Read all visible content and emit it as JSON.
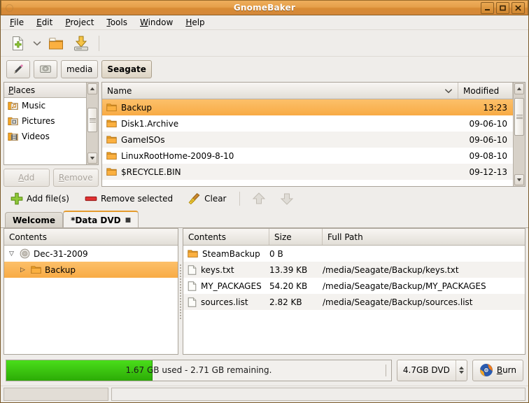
{
  "window": {
    "title": "GnomeBaker",
    "minimize_label": "Minimize",
    "maximize_label": "Maximize",
    "close_label": "Close"
  },
  "menubar": {
    "items": [
      {
        "label": "File",
        "mnemonic": "F"
      },
      {
        "label": "Edit",
        "mnemonic": "E"
      },
      {
        "label": "Project",
        "mnemonic": "P"
      },
      {
        "label": "Tools",
        "mnemonic": "T"
      },
      {
        "label": "Window",
        "mnemonic": "W"
      },
      {
        "label": "Help",
        "mnemonic": "H"
      }
    ]
  },
  "toolbar": {
    "new_label": "New",
    "new_dropdown_label": "New project type",
    "open_label": "Open",
    "save_label": "Save",
    "icons": [
      "new-document-icon",
      "chevron-down-icon",
      "open-folder-icon",
      "save-disk-icon"
    ]
  },
  "pathbar": {
    "edit_location_label": "Edit location",
    "buttons": [
      {
        "label": "",
        "icon": "drive-icon"
      },
      {
        "label": "media",
        "icon": ""
      },
      {
        "label": "Seagate",
        "icon": "",
        "current": true
      }
    ]
  },
  "places": {
    "header": "Places",
    "header_mnemonic": "P",
    "items": [
      {
        "label": "Music",
        "icon": "music-folder-icon"
      },
      {
        "label": "Pictures",
        "icon": "pictures-folder-icon"
      },
      {
        "label": "Videos",
        "icon": "videos-folder-icon"
      }
    ],
    "add_label": "Add",
    "remove_label": "Remove"
  },
  "filelist": {
    "columns": {
      "name": "Name",
      "modified": "Modified"
    },
    "sort_indicator": "chevron-down-icon",
    "rows": [
      {
        "name": "Backup",
        "modified": "13:23",
        "selected": true
      },
      {
        "name": "Disk1.Archive",
        "modified": "09-06-10",
        "selected": false
      },
      {
        "name": "GameISOs",
        "modified": "09-06-10",
        "selected": false
      },
      {
        "name": "LinuxRootHome-2009-8-10",
        "modified": "09-08-10",
        "selected": false
      },
      {
        "name": "$RECYCLE.BIN",
        "modified": "09-12-13",
        "selected": false
      }
    ]
  },
  "actions": {
    "add_files": "Add file(s)",
    "remove_selected": "Remove selected",
    "clear": "Clear",
    "move_up_label": "Move up",
    "move_down_label": "Move down"
  },
  "tabs": [
    {
      "label": "Welcome",
      "active": false,
      "mark": ""
    },
    {
      "label": "*Data DVD",
      "active": true,
      "mark": "■"
    }
  ],
  "tree": {
    "header": "Contents",
    "nodes": [
      {
        "label": "Dec-31-2009",
        "icon": "disc-icon",
        "expander": "▽",
        "indent": 0,
        "selected": false
      },
      {
        "label": "Backup",
        "icon": "folder-icon",
        "expander": "▷",
        "indent": 1,
        "selected": true
      }
    ]
  },
  "contents": {
    "columns": {
      "name": "Contents",
      "size": "Size",
      "path": "Full Path"
    },
    "rows": [
      {
        "name": "SteamBackup",
        "size": "0 B",
        "path": "",
        "icon": "folder-icon"
      },
      {
        "name": "keys.txt",
        "size": "13.39 KB",
        "path": "/media/Seagate/Backup/keys.txt",
        "icon": "file-icon"
      },
      {
        "name": "MY_PACKAGES",
        "size": "54.20 KB",
        "path": "/media/Seagate/Backup/MY_PACKAGES",
        "icon": "file-icon"
      },
      {
        "name": "sources.list",
        "size": "2.82 KB",
        "path": "/media/Seagate/Backup/sources.list",
        "icon": "file-icon"
      }
    ]
  },
  "burnbar": {
    "progress_text": "1.67 GB used - 2.71 GB remaining.",
    "progress_percent": 38,
    "used": "1.67 GB",
    "remaining": "2.71 GB",
    "media_size": "4.7GB DVD",
    "burn_label": "Burn",
    "burn_mnemonic": "B"
  },
  "statusbar": {
    "left_text": "",
    "right_text": ""
  },
  "colors": {
    "titlebar": "#e29b43",
    "selection": "#f8ab45",
    "progress": "#3ccf12",
    "window_bg": "#efedea",
    "tab_active_accent": "#e59b2e"
  }
}
